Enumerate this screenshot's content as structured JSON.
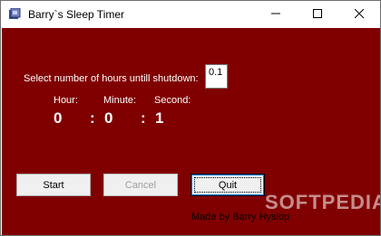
{
  "window": {
    "title": "Barry`s Sleep Timer",
    "icon": "app-icon",
    "controls": [
      "minimize-icon",
      "maximize-icon",
      "close-icon"
    ]
  },
  "form": {
    "prompt": "Select number of hours untill shutdown:",
    "hours_value": "0.1"
  },
  "countdown": {
    "hour_label": "Hour:",
    "minute_label": "Minute:",
    "second_label": "Second:",
    "hour_value": "0",
    "minute_value": "0",
    "second_value": "1",
    "separator_1": ":",
    "separator_2": ":"
  },
  "buttons": {
    "start": "Start",
    "cancel": "Cancel",
    "quit": "Quit"
  },
  "credit": "Made by Barry Hyslop",
  "watermark": "SOFTPEDIA",
  "colors": {
    "background": "#800000",
    "text": "#ffffff",
    "button": "#f0f0f0"
  }
}
